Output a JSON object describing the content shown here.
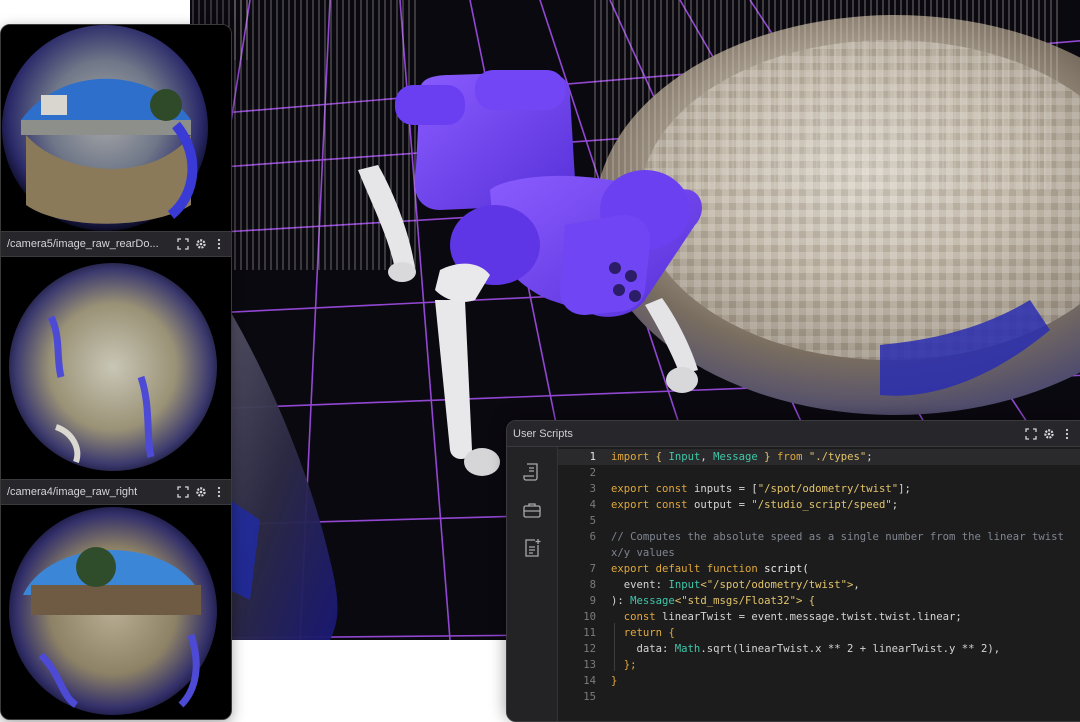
{
  "camera_panels": [
    {
      "title": ""
    },
    {
      "title": "/camera5/image_raw_rearDo..."
    },
    {
      "title": "/camera4/image_raw_right"
    }
  ],
  "scripts_panel": {
    "title": "User Scripts",
    "line_numbers": [
      "1",
      "2",
      "3",
      "4",
      "5",
      "6",
      "",
      "7",
      "8",
      "9",
      "10",
      "11",
      "12",
      "13",
      "14",
      "15"
    ],
    "active_line": "1"
  },
  "code": {
    "l1": {
      "kw1": "import",
      "b1": "{",
      "t1": "Input",
      "c1": ",",
      "t2": "Message",
      "b2": "}",
      "kw2": "from",
      "s1": "\"./types\"",
      "e": ";"
    },
    "l3": {
      "kw1": "export",
      "kw2": "const",
      "v": "inputs",
      "op": "= [",
      "s": "\"/spot/odometry/twist\"",
      "e": "];"
    },
    "l4": {
      "kw1": "export",
      "kw2": "const",
      "v": "output",
      "op": "=",
      "s": "\"/studio_script/speed\"",
      "e": ";"
    },
    "l6a": "// Computes the absolute speed as a single number from the linear twist",
    "l6b": "x/y values",
    "l7": {
      "kw1": "export",
      "kw2": "default",
      "kw3": "function",
      "fn": "script("
    },
    "l8": {
      "p": "event:",
      "t": "Input",
      "s": "<\"/spot/odometry/twist\">",
      "e": ","
    },
    "l9": {
      "a": "):",
      "t": "Message",
      "s": "<\"std_msgs/Float32\">",
      "e": "{"
    },
    "l10": {
      "kw": "const",
      "rest": "linearTwist = event.message.twist.twist.linear;"
    },
    "l11": {
      "kw": "return",
      "rest": "{"
    },
    "l12": {
      "p": "data:",
      "t": "Math",
      "rest": ".sqrt(linearTwist.x ** 2 + linearTwist.y ** 2),"
    },
    "l13": "};",
    "l14": "}"
  },
  "colors": {
    "robot": "#6e3df0",
    "grid": "#a04ee8",
    "keyword": "#e0a83c",
    "type": "#3fc7a8",
    "string": "#e3c46b"
  },
  "icons": {
    "toolbar": [
      "expand-icon",
      "gear-icon",
      "kebab-menu-icon"
    ],
    "rail": [
      "script-icon",
      "briefcase-icon",
      "add-note-icon"
    ]
  }
}
